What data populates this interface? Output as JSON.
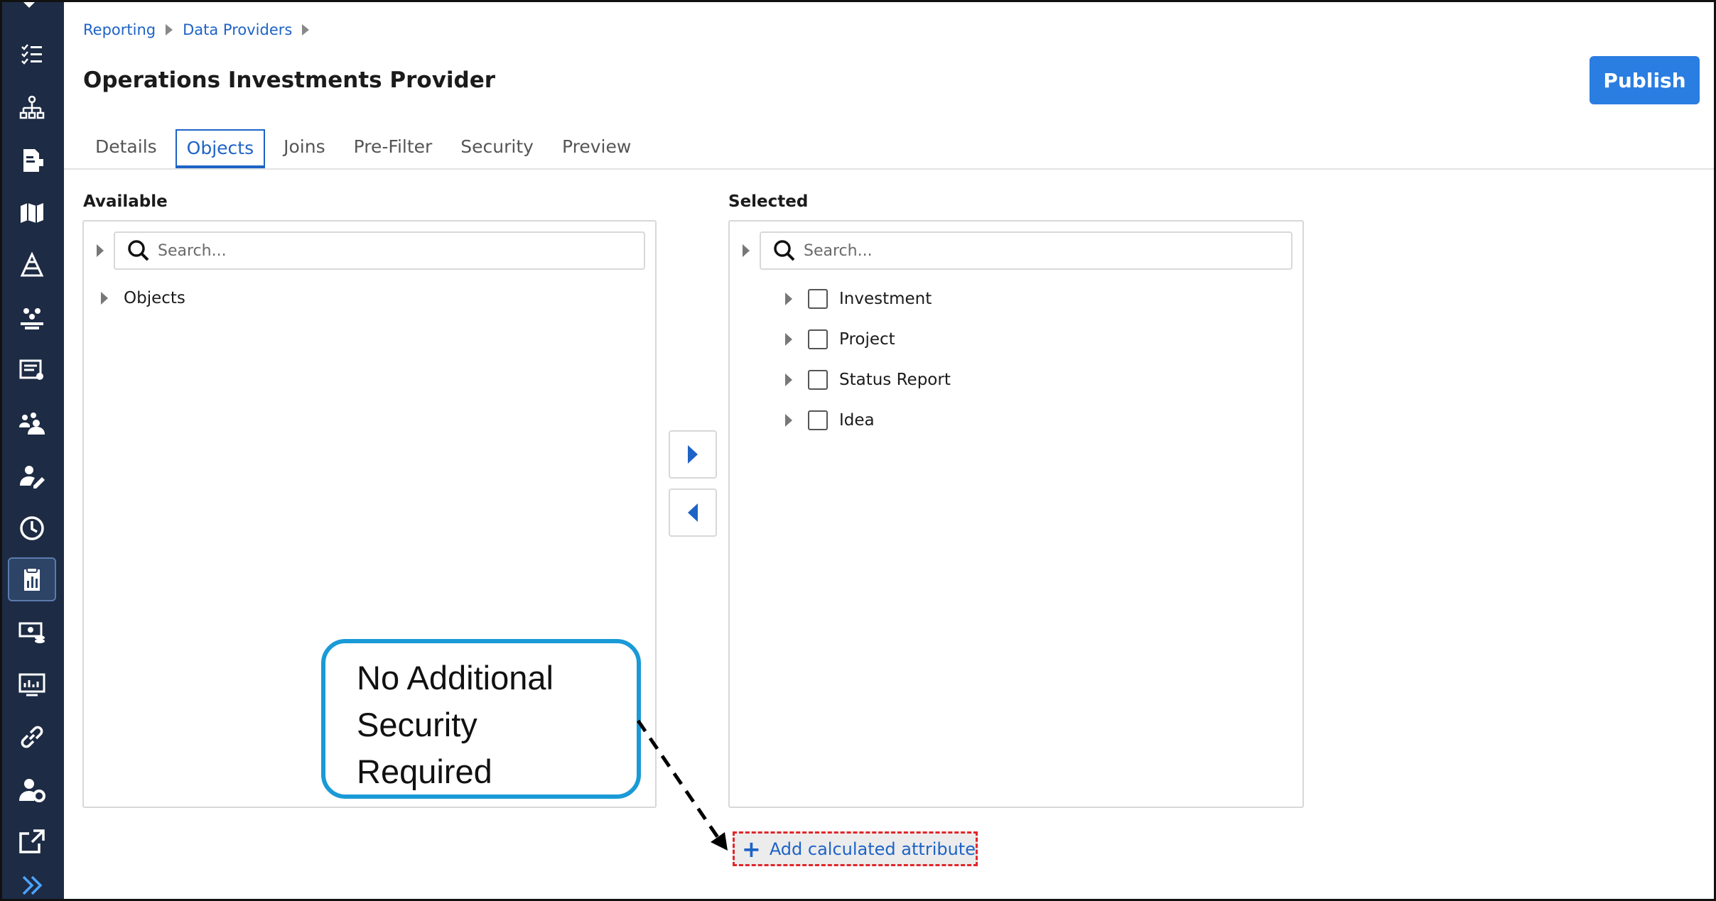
{
  "breadcrumb": {
    "items": [
      "Reporting",
      "Data Providers"
    ]
  },
  "page": {
    "title": "Operations Investments Provider",
    "publish_label": "Publish"
  },
  "tabs": [
    {
      "label": "Details",
      "active": false
    },
    {
      "label": "Objects",
      "active": true
    },
    {
      "label": "Joins",
      "active": false
    },
    {
      "label": "Pre-Filter",
      "active": false
    },
    {
      "label": "Security",
      "active": false
    },
    {
      "label": "Preview",
      "active": false
    }
  ],
  "available": {
    "label": "Available",
    "search_placeholder": "Search...",
    "items": [
      "Objects"
    ]
  },
  "selected": {
    "label": "Selected",
    "search_placeholder": "Search...",
    "items": [
      "Investment",
      "Project",
      "Status Report",
      "Idea"
    ]
  },
  "add_attribute": {
    "label": "Add calculated attribute"
  },
  "callout": {
    "lines": [
      "No Additional",
      "Security",
      "Required"
    ]
  },
  "sidebar": {
    "icons": [
      "checklist-icon",
      "hierarchy-icon",
      "documents-icon",
      "map-icon",
      "pyramid-icon",
      "team-icon",
      "form-icon",
      "people-icon",
      "user-edit-icon",
      "clock-icon",
      "reports-icon",
      "finance-icon",
      "dashboard-icon",
      "link-icon",
      "admin-gear-icon",
      "external-link-icon",
      "expand-icon"
    ],
    "active_icon": "reports-icon"
  },
  "colors": {
    "sidebar_bg": "#1d2b44",
    "accent": "#2a7de1",
    "link": "#1e63c6",
    "callout_border": "#1a9ad6",
    "dashed_border": "#e0262b"
  }
}
